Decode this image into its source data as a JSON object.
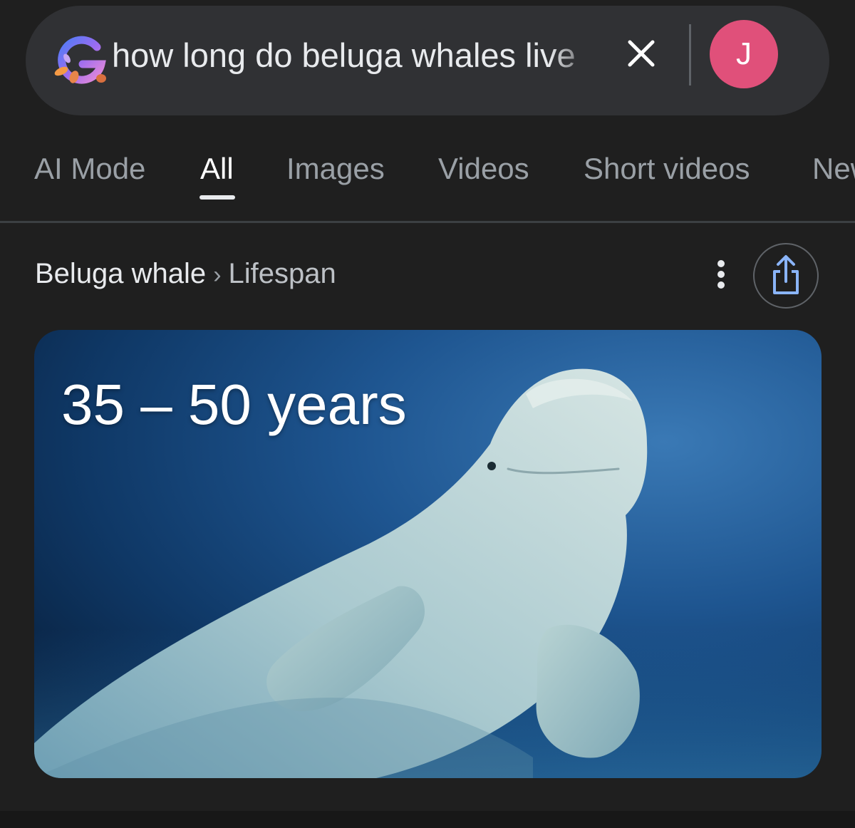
{
  "search": {
    "query": "how long do beluga whales live",
    "logo_icon": "google-g-logo-icon",
    "clear_icon": "close-icon",
    "account_initial": "J",
    "account_color": "#e0507a"
  },
  "tabs": [
    {
      "label": "AI Mode",
      "active": false
    },
    {
      "label": "All",
      "active": true
    },
    {
      "label": "Images",
      "active": false
    },
    {
      "label": "Videos",
      "active": false
    },
    {
      "label": "Short videos",
      "active": false
    },
    {
      "label": "News",
      "active": false
    }
  ],
  "result": {
    "breadcrumb_main": "Beluga whale",
    "breadcrumb_separator": "›",
    "breadcrumb_sub": "Lifespan",
    "more_icon": "more-vert-icon",
    "share_icon": "share-icon",
    "answer": "35 – 50 years",
    "image_subject": "beluga-whale-image"
  },
  "colors": {
    "background": "#1f1f1f",
    "search_bar": "#303134",
    "text_primary": "#e8eaed",
    "text_secondary": "#9aa0a6",
    "accent_blue": "#8ab4f8"
  }
}
